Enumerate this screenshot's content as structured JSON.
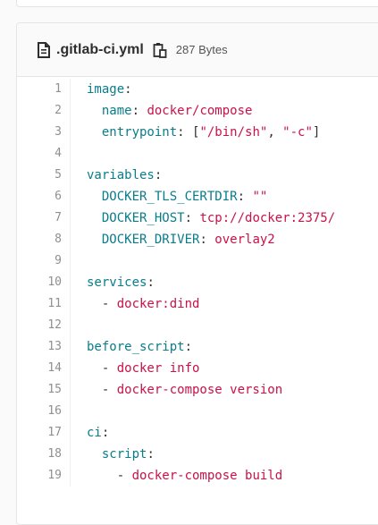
{
  "file": {
    "name": ".gitlab-ci.yml",
    "size": "287 Bytes",
    "icon": "file-icon",
    "copy_icon": "copy-icon"
  },
  "colors": {
    "key": "#0a7c8a",
    "string": "#c8124a",
    "text": "#2e2e2e",
    "line_number": "#8f8f8f"
  },
  "lines": [
    {
      "n": "1",
      "indent": "",
      "key": "image",
      "sep": ":",
      "val": ""
    },
    {
      "n": "2",
      "indent": "  ",
      "key": "name",
      "sep": ": ",
      "val": "docker/compose"
    },
    {
      "n": "3",
      "indent": "  ",
      "key": "entrypoint",
      "sep": ": ",
      "arr": [
        "\"/bin/sh\"",
        "\"-c\""
      ]
    },
    {
      "n": "4",
      "indent": "",
      "key": "",
      "sep": "",
      "val": ""
    },
    {
      "n": "5",
      "indent": "",
      "key": "variables",
      "sep": ":",
      "val": ""
    },
    {
      "n": "6",
      "indent": "  ",
      "key": "DOCKER_TLS_CERTDIR",
      "sep": ": ",
      "val": "\"\""
    },
    {
      "n": "7",
      "indent": "  ",
      "key": "DOCKER_HOST",
      "sep": ": ",
      "val": "tcp://docker:2375/"
    },
    {
      "n": "8",
      "indent": "  ",
      "key": "DOCKER_DRIVER",
      "sep": ": ",
      "val": "overlay2"
    },
    {
      "n": "9",
      "indent": "",
      "key": "",
      "sep": "",
      "val": ""
    },
    {
      "n": "10",
      "indent": "",
      "key": "services",
      "sep": ":",
      "val": ""
    },
    {
      "n": "11",
      "indent": "  ",
      "dash": "- ",
      "val": "docker:dind"
    },
    {
      "n": "12",
      "indent": "",
      "key": "",
      "sep": "",
      "val": ""
    },
    {
      "n": "13",
      "indent": "",
      "key": "before_script",
      "sep": ":",
      "val": ""
    },
    {
      "n": "14",
      "indent": "  ",
      "dash": "- ",
      "val": "docker info"
    },
    {
      "n": "15",
      "indent": "  ",
      "dash": "- ",
      "val": "docker-compose version"
    },
    {
      "n": "16",
      "indent": "",
      "key": "",
      "sep": "",
      "val": ""
    },
    {
      "n": "17",
      "indent": "",
      "key": "ci",
      "sep": ":",
      "val": ""
    },
    {
      "n": "18",
      "indent": "  ",
      "key": "script",
      "sep": ":",
      "val": ""
    },
    {
      "n": "19",
      "indent": "    ",
      "dash": "- ",
      "val": "docker-compose build"
    }
  ]
}
